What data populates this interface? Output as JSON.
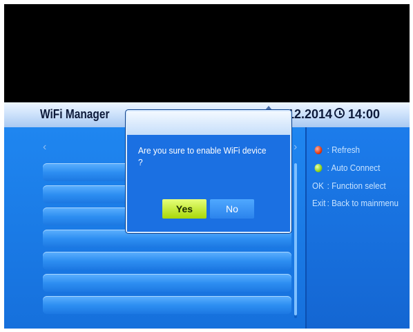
{
  "header": {
    "title": "WiFi Manager",
    "date": "12.2014",
    "time": "14:00"
  },
  "list": {
    "prev_arrow": "‹",
    "next_arrow": "›",
    "rows": [
      "",
      "",
      "",
      "",
      "",
      "",
      ""
    ]
  },
  "legend": {
    "refresh": {
      "key": "red-dot",
      "label": ": Refresh"
    },
    "auto_connect": {
      "key": "green-dot",
      "label": ": Auto Connect"
    },
    "function_select": {
      "key": "OK",
      "label": ": Function select"
    },
    "back": {
      "key": "Exit",
      "label": ": Back to mainmenu"
    }
  },
  "dialog": {
    "message": "Are you sure to enable WiFi device ?",
    "yes_label": "Yes",
    "no_label": "No",
    "selected": "Yes"
  },
  "colors": {
    "background": "#1e7ae6",
    "header": "#cfe3fb",
    "selected_button": "#c6f01e",
    "unselected_button": "#2b83ec"
  }
}
